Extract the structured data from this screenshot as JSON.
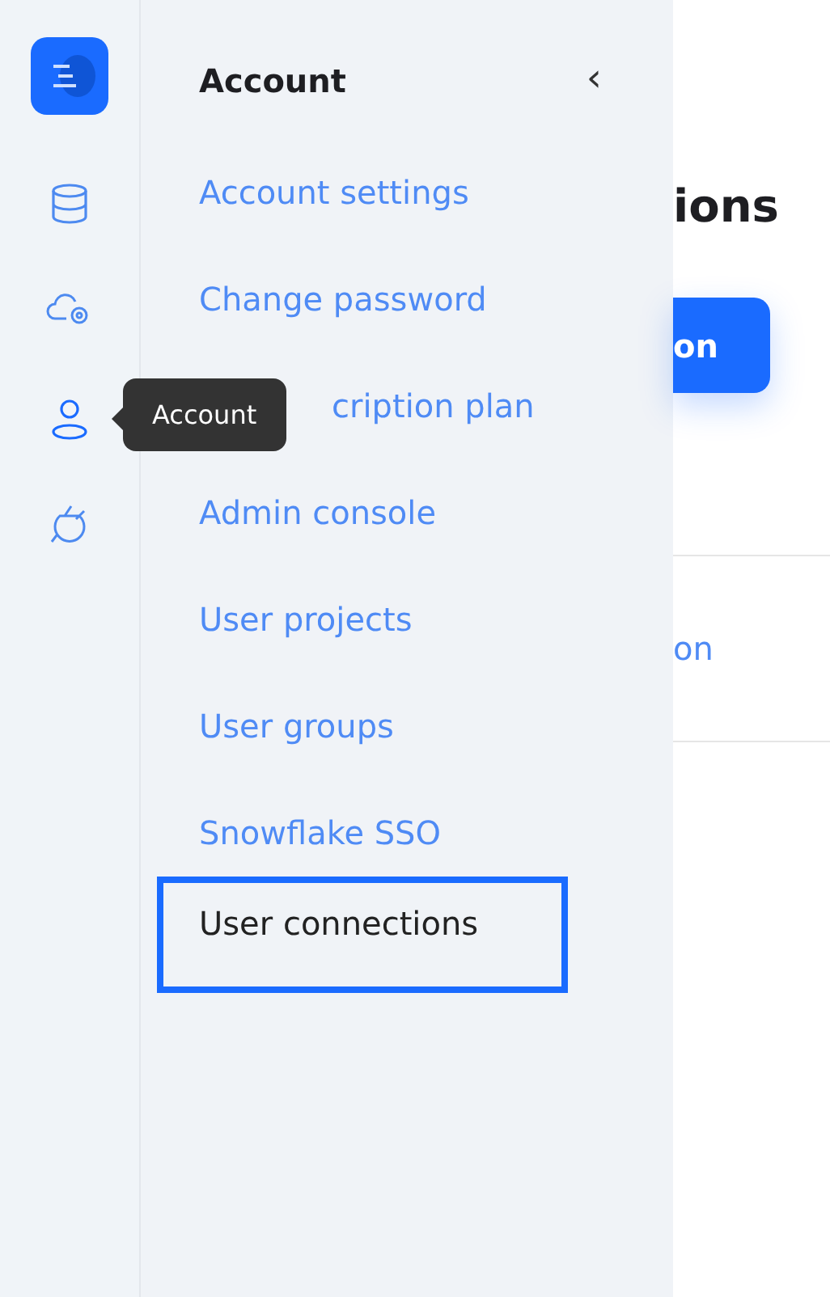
{
  "rail": {
    "items": [
      {
        "kind": "database",
        "selected": false
      },
      {
        "kind": "cloud",
        "selected": false
      },
      {
        "kind": "user",
        "selected": true
      },
      {
        "kind": "plug",
        "selected": false
      }
    ]
  },
  "tooltip": {
    "text": "Account"
  },
  "sidebar": {
    "title": "Account",
    "collapse": "‹",
    "items": [
      {
        "label": "Account settings",
        "selected": false,
        "covered": false
      },
      {
        "label": "Change password",
        "selected": false,
        "covered": false
      },
      {
        "label": "cription plan",
        "selected": false,
        "covered": true
      },
      {
        "label": "Admin console",
        "selected": false,
        "covered": false
      },
      {
        "label": "User projects",
        "selected": false,
        "covered": false
      },
      {
        "label": "User groups",
        "selected": false,
        "covered": false
      },
      {
        "label": "Snowflake SSO",
        "selected": false,
        "covered": false
      },
      {
        "label": "User connections",
        "selected": true,
        "covered": false
      }
    ]
  },
  "main": {
    "heading": "ions",
    "button": "on",
    "link": "on"
  }
}
